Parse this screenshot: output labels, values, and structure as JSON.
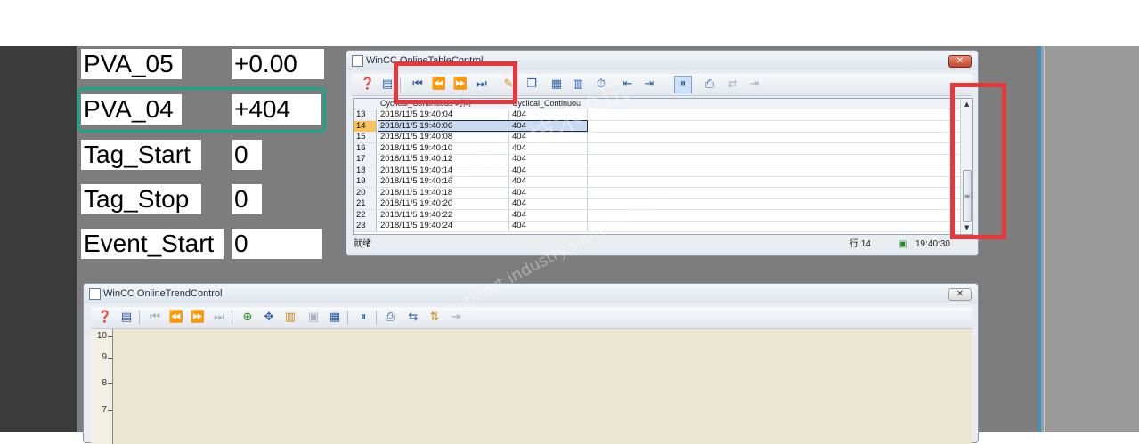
{
  "tags": [
    {
      "name": "PVA_05",
      "value": "+0.00"
    },
    {
      "name": "PVA_04",
      "value": "+404"
    },
    {
      "name": "Tag_Start",
      "value": "0"
    },
    {
      "name": "Tag_Stop",
      "value": "0"
    },
    {
      "name": "Event_Start",
      "value": "0"
    }
  ],
  "table_window": {
    "title": "WinCC OnlineTableControl",
    "close": "✕",
    "columns": [
      "Cyclical_Continuous 时间",
      "Cyclical_Continuou"
    ],
    "rows": [
      {
        "n": "13",
        "time": "2018/11/5 19:40:04",
        "value": "404"
      },
      {
        "n": "14",
        "time": "2018/11/5 19:40:06",
        "value": "404"
      },
      {
        "n": "15",
        "time": "2018/11/5 19:40:08",
        "value": "404"
      },
      {
        "n": "16",
        "time": "2018/11/5 19:40:10",
        "value": "404"
      },
      {
        "n": "17",
        "time": "2018/11/5 19:40:12",
        "value": "404"
      },
      {
        "n": "18",
        "time": "2018/11/5 19:40:14",
        "value": "404"
      },
      {
        "n": "19",
        "time": "2018/11/5 19:40:16",
        "value": "404"
      },
      {
        "n": "20",
        "time": "2018/11/5 19:40:18",
        "value": "404"
      },
      {
        "n": "21",
        "time": "2018/11/5 19:40:20",
        "value": "404"
      },
      {
        "n": "22",
        "time": "2018/11/5 19:40:22",
        "value": "404"
      },
      {
        "n": "23",
        "time": "2018/11/5 19:40:24",
        "value": "404"
      }
    ],
    "selected_row": "14",
    "status_left": "就绪",
    "status_row": "行 14",
    "status_time": "19:40:30"
  },
  "trend_window": {
    "title": "WinCC OnlineTrendControl",
    "close": "✕",
    "y_ticks": [
      "10",
      "9",
      "8",
      "7"
    ]
  },
  "watermark": {
    "line1": "西门子工业 技术论坛",
    "line2": "support.industry.siemens.com/cs"
  },
  "colors": {
    "highlight_red": "#e8373a",
    "focus_green": "#1aa58a",
    "selection_blue": "#c9daf2",
    "row_header_selected": "#f7c35a"
  }
}
